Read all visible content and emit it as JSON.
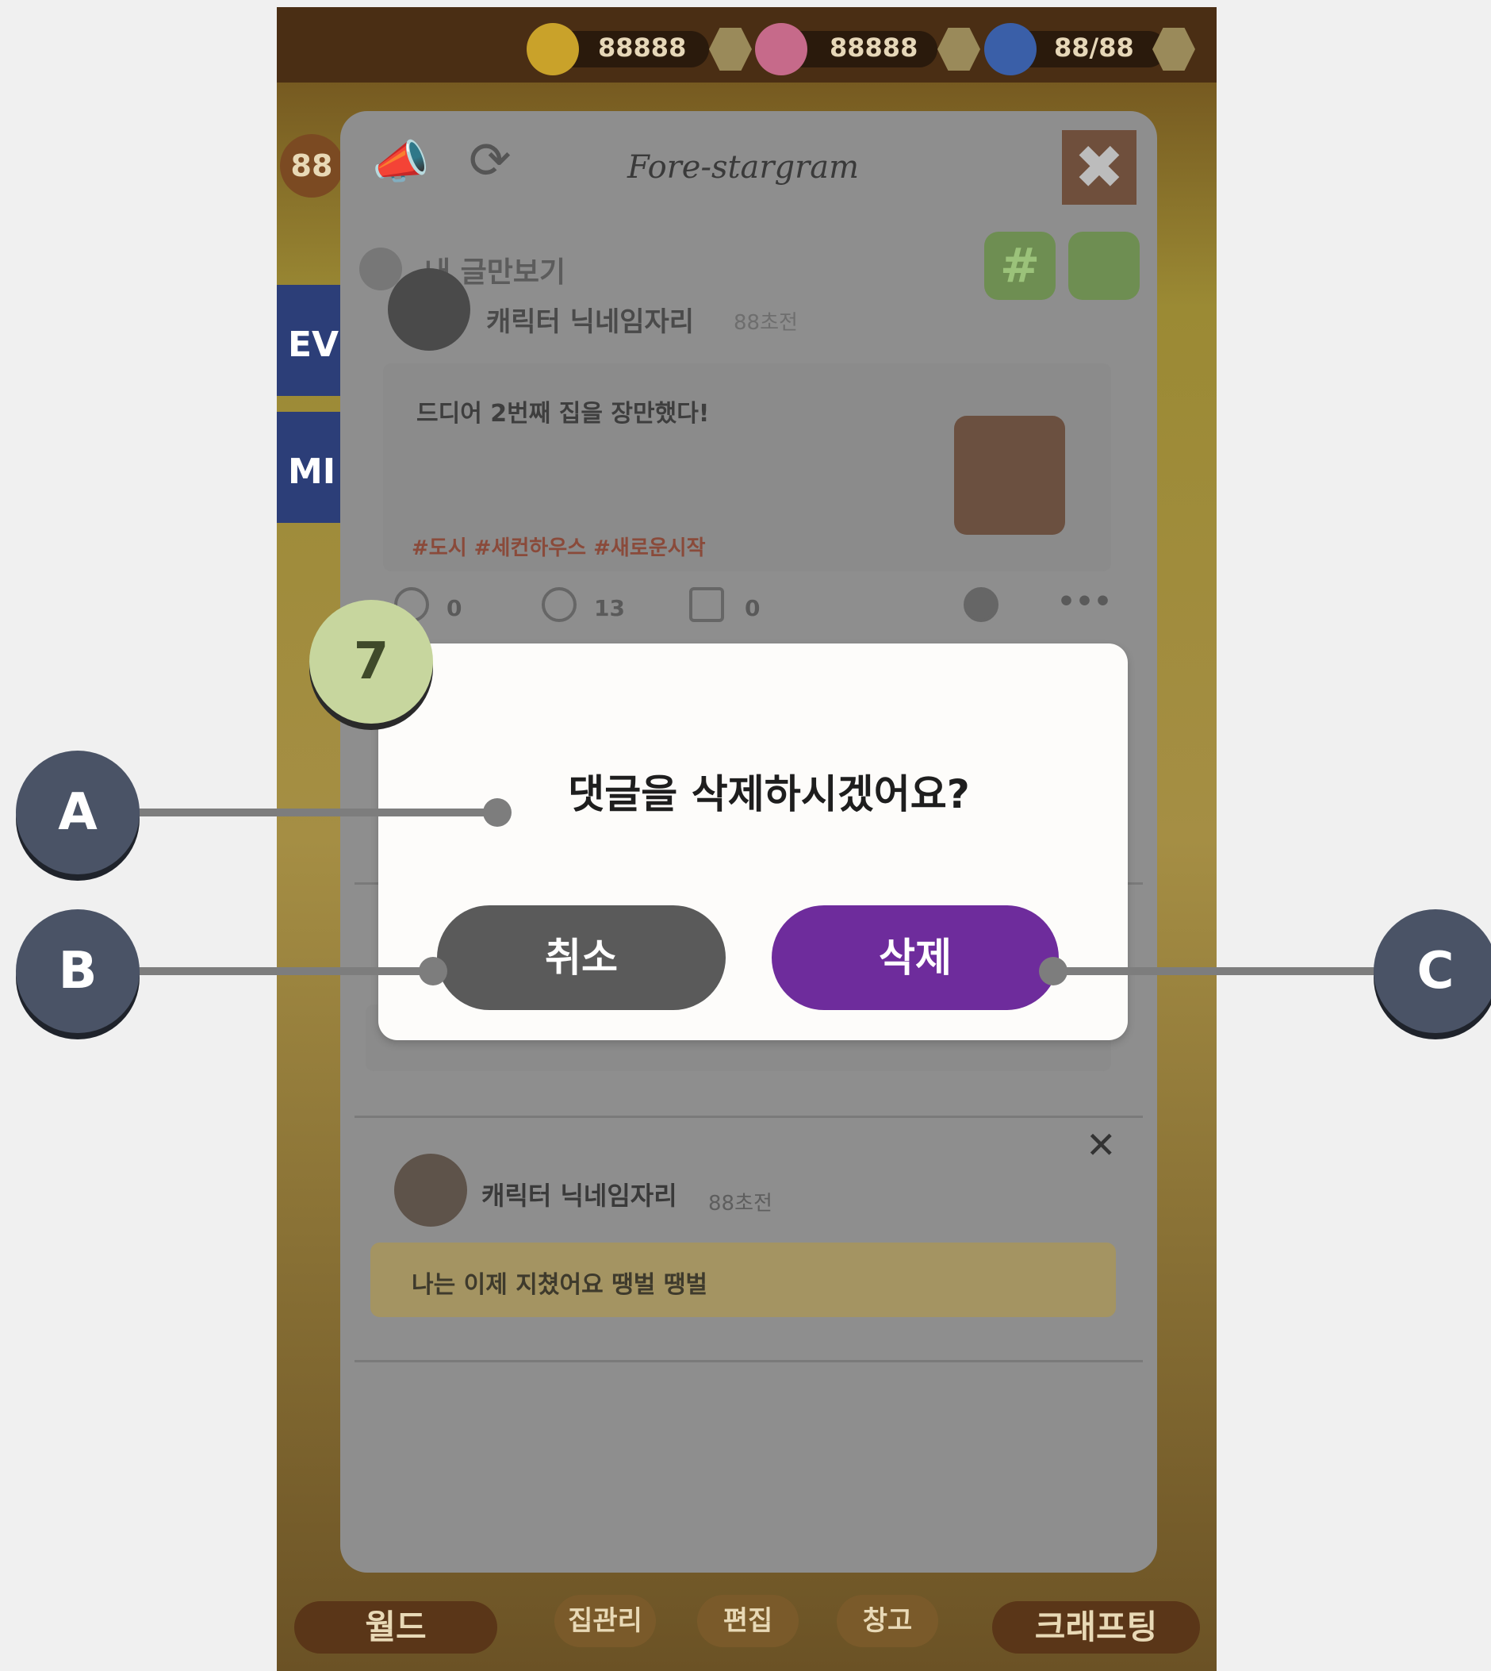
{
  "hud": {
    "coins": "88888",
    "stars": "88888",
    "gems": "88/88",
    "level": "88",
    "side_banners": [
      "EV",
      "MI"
    ],
    "bottom_tabs": [
      "월드",
      "집관리",
      "편집",
      "창고",
      "크래프팅"
    ]
  },
  "feed": {
    "title": "Fore-stargram",
    "filter_label": "내 글만보기",
    "hash_label": "#",
    "post": {
      "author": "캐릭터 닉네임자리",
      "time": "88초전",
      "text": "드디어 2번째 집을 장만했다!",
      "tags": "#도시 #세컨하우스 #새로운시작",
      "comment_count": "0",
      "like_count": "13",
      "share_count": "0"
    },
    "comment": {
      "author": "캐릭터 닉네임자리",
      "time": "88초전",
      "text": "나는 이제 지쳤어요 땡벌 땡벌"
    }
  },
  "dialog": {
    "message": "댓글을 삭제하시겠어요?",
    "cancel_label": "취소",
    "delete_label": "삭제"
  },
  "annotations": {
    "step": "7",
    "a": "A",
    "b": "B",
    "c": "C"
  },
  "colors": {
    "delete_button": "#6e2c9c",
    "cancel_button": "#5a5a5a",
    "step_badge": "#c7d69e",
    "callout": "#4a5366"
  }
}
